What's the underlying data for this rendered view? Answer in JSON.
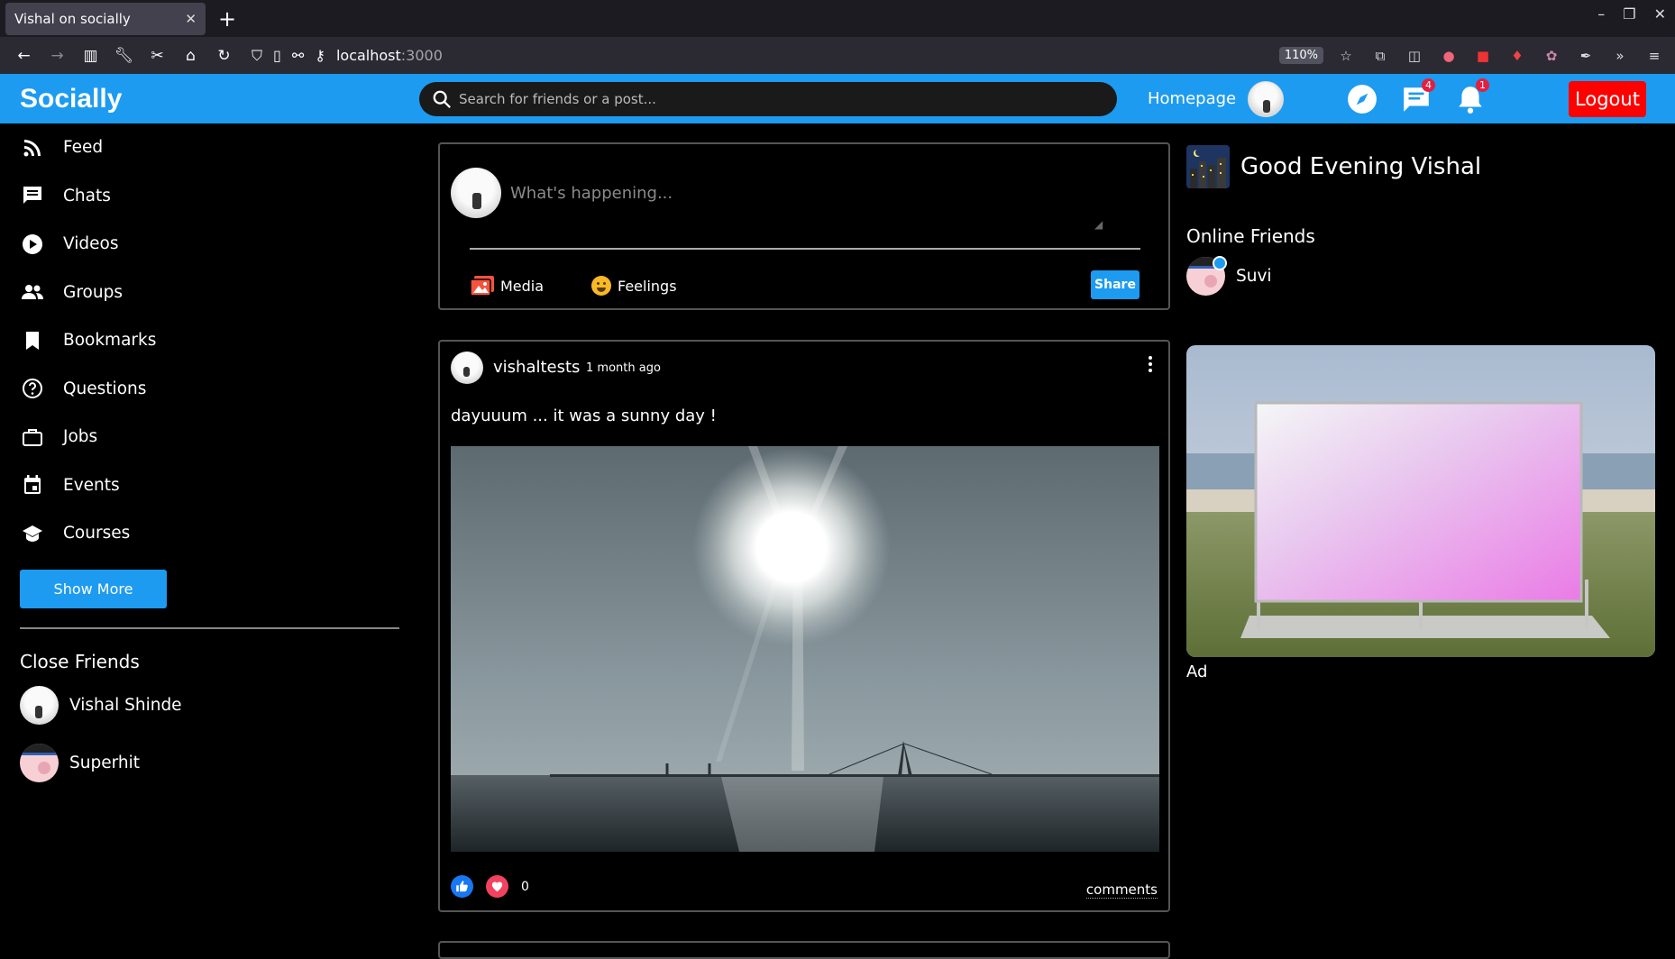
{
  "browser": {
    "tab_title": "Vishal on socially",
    "url_host": "localhost",
    "url_port": ":3000",
    "zoom": "110%"
  },
  "header": {
    "logo": "Socially",
    "search_placeholder": "Search for friends or a post...",
    "homepage": "Homepage",
    "messages_badge": "4",
    "notifications_badge": "1",
    "logout": "Logout"
  },
  "sidebar": {
    "items": [
      {
        "label": "Feed",
        "icon": "rss-icon"
      },
      {
        "label": "Chats",
        "icon": "chat-icon"
      },
      {
        "label": "Videos",
        "icon": "play-circle-icon"
      },
      {
        "label": "Groups",
        "icon": "group-icon"
      },
      {
        "label": "Bookmarks",
        "icon": "bookmark-icon"
      },
      {
        "label": "Questions",
        "icon": "help-circle-icon"
      },
      {
        "label": "Jobs",
        "icon": "briefcase-icon"
      },
      {
        "label": "Events",
        "icon": "calendar-icon"
      },
      {
        "label": "Courses",
        "icon": "school-icon"
      }
    ],
    "show_more": "Show More",
    "close_friends_title": "Close Friends",
    "close_friends": [
      "Vishal Shinde",
      "Superhit"
    ]
  },
  "composer": {
    "placeholder": "What's happening...",
    "media": "Media",
    "feelings": "Feelings",
    "share": "Share"
  },
  "post": {
    "username": "vishaltests",
    "time": "1 month ago",
    "text": "dayuuum ... it was a sunny day !",
    "like_count": "0",
    "comments": "comments"
  },
  "right": {
    "greeting": "Good Evening Vishal",
    "online_title": "Online Friends",
    "online_friends": [
      "Suvi"
    ],
    "ad_label": "Ad"
  },
  "colors": {
    "brand": "#1d9bf0",
    "logout": "#ff0000"
  }
}
